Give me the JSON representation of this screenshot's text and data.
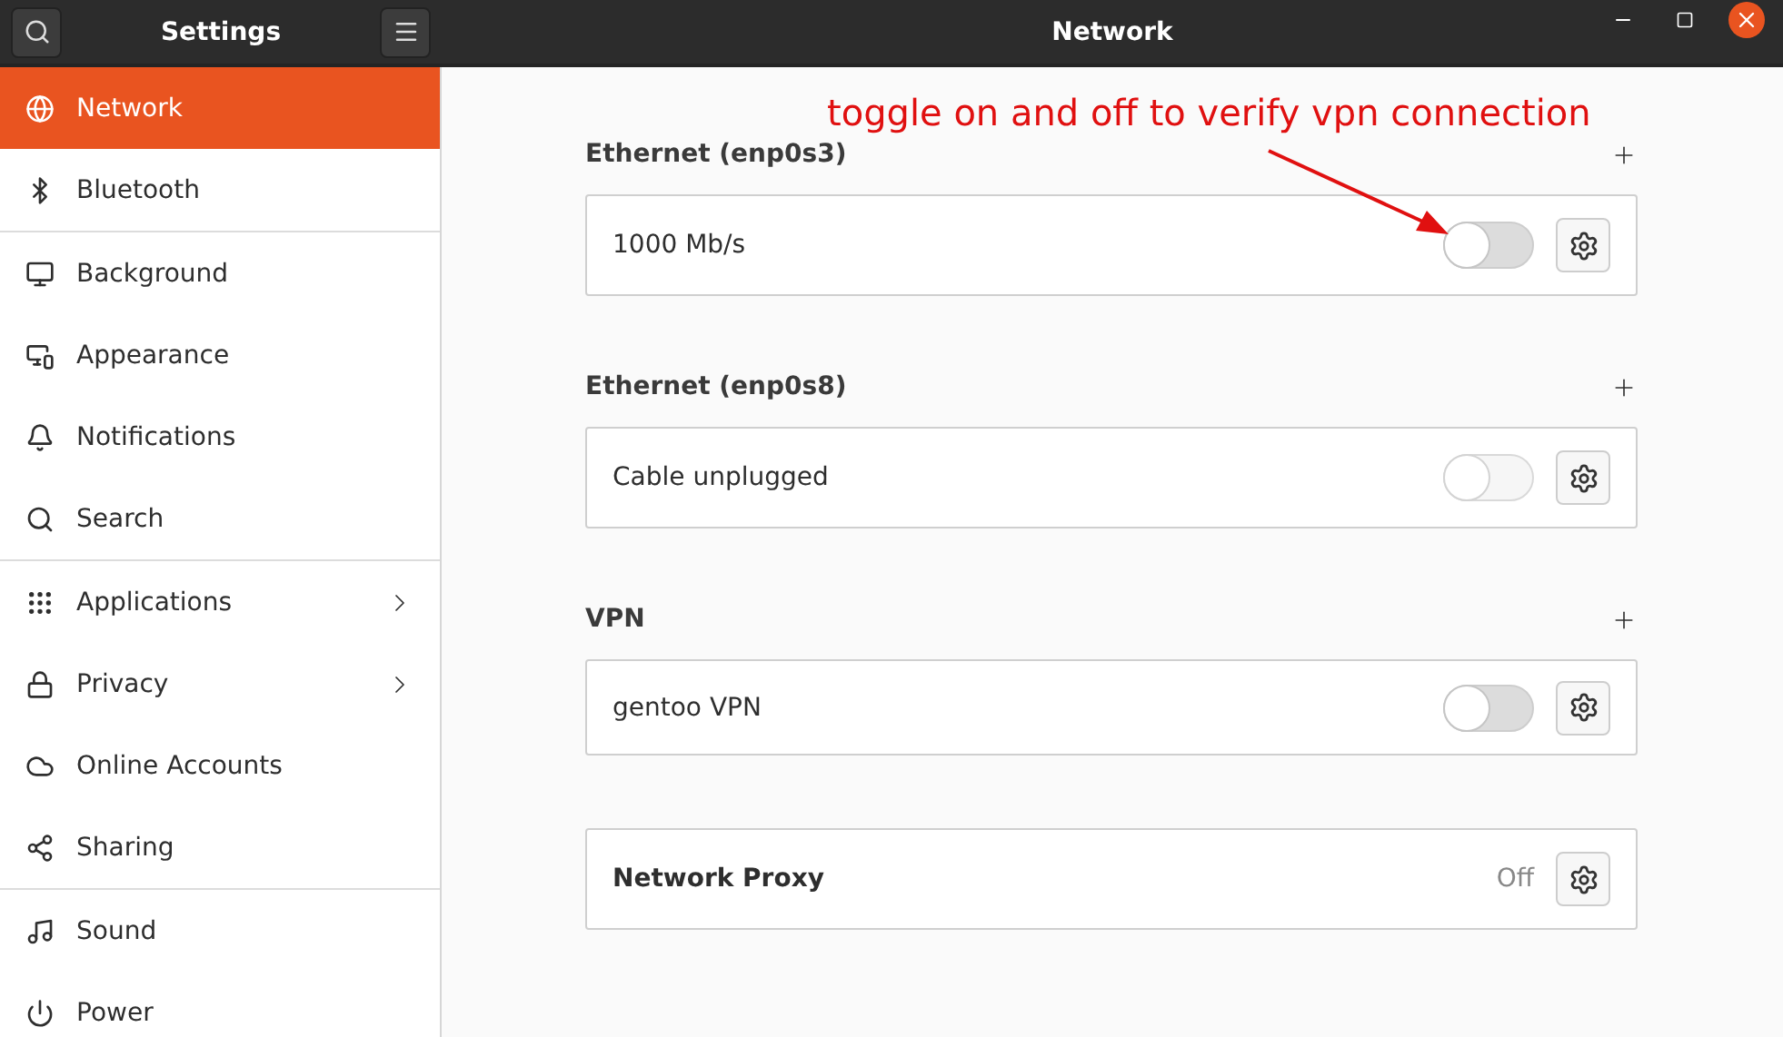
{
  "header": {
    "sidebar_title": "Settings",
    "title": "Network"
  },
  "sidebar": {
    "groups": [
      [
        {
          "label": "Network",
          "selected": true,
          "submenu": false
        },
        {
          "label": "Bluetooth",
          "selected": false,
          "submenu": false
        }
      ],
      [
        {
          "label": "Background",
          "selected": false,
          "submenu": false
        },
        {
          "label": "Appearance",
          "selected": false,
          "submenu": false
        },
        {
          "label": "Notifications",
          "selected": false,
          "submenu": false
        },
        {
          "label": "Search",
          "selected": false,
          "submenu": false
        }
      ],
      [
        {
          "label": "Applications",
          "selected": false,
          "submenu": true
        },
        {
          "label": "Privacy",
          "selected": false,
          "submenu": true
        },
        {
          "label": "Online Accounts",
          "selected": false,
          "submenu": false
        },
        {
          "label": "Sharing",
          "selected": false,
          "submenu": false
        }
      ],
      [
        {
          "label": "Sound",
          "selected": false,
          "submenu": false
        },
        {
          "label": "Power",
          "selected": false,
          "submenu": false
        }
      ]
    ]
  },
  "sections": [
    {
      "title": "Ethernet (enp0s3)",
      "rows": [
        {
          "kind": "toggle",
          "label": "1000 Mb/s",
          "on": false,
          "disabled": false
        }
      ]
    },
    {
      "title": "Ethernet (enp0s8)",
      "rows": [
        {
          "kind": "toggle",
          "label": "Cable unplugged",
          "on": false,
          "disabled": true
        }
      ]
    },
    {
      "title": "VPN",
      "rows": [
        {
          "kind": "toggle",
          "label": "gentoo VPN",
          "on": false,
          "disabled": false
        }
      ]
    },
    {
      "rows": [
        {
          "kind": "status",
          "label": "Network Proxy",
          "status": "Off"
        }
      ]
    }
  ],
  "annotation": {
    "text": "toggle on and off to verify vpn connection"
  }
}
